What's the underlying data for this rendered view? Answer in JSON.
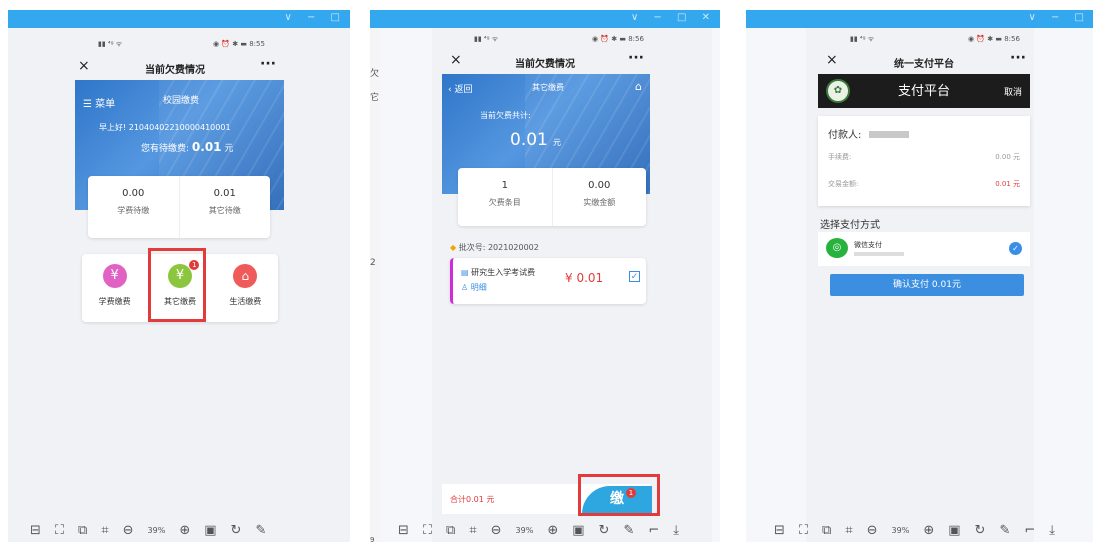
{
  "screen1": {
    "status_time": "8:55",
    "nav_title": "当前欠费情况",
    "menu_label": "菜单",
    "banner_title": "校园缴费",
    "greeting": "早上好! 21040402210000410001",
    "pending_prefix": "您有待缴费:",
    "pending_amount": "0.01",
    "pending_unit": "元",
    "stats": [
      {
        "value": "0.00",
        "label": "学费待缴"
      },
      {
        "value": "0.01",
        "label": "其它待缴"
      }
    ],
    "categories": [
      {
        "label": "学费缴费",
        "color": "#e063c4",
        "icon": "yen-icon"
      },
      {
        "label": "其它缴费",
        "color": "#8cc63f",
        "icon": "yen-icon",
        "badge": "1"
      },
      {
        "label": "生活缴费",
        "color": "#f05a5a",
        "icon": "store-icon"
      }
    ],
    "zoom": "39%"
  },
  "screen2": {
    "status_time": "8:56",
    "nav_title": "当前欠费情况",
    "back_label": "返回",
    "banner_title": "其它缴费",
    "owed_label": "当前欠费共计:",
    "owed_amount": "0.01",
    "owed_unit": "元",
    "stats": [
      {
        "value": "1",
        "label": "欠费条目"
      },
      {
        "value": "0.00",
        "label": "实缴金额"
      }
    ],
    "batch_label": "批次号: 2021020002",
    "item_name": "研究生入学考试费",
    "item_detail": "明细",
    "item_amount": "¥ 0.01",
    "total_label": "合计0.01  元",
    "pay_button_label": "缴",
    "pay_badge": "1",
    "zoom": "39%",
    "side_chars": [
      "欠",
      "它",
      "2",
      "9"
    ]
  },
  "screen3": {
    "status_time": "8:56",
    "nav_title": "统一支付平台",
    "header_title": "支付平台",
    "cancel_label": "取消",
    "payer_label": "付款人:",
    "fee_label": "手续费:",
    "fee_value": "0.00 元",
    "amount_label": "交易金额:",
    "amount_value": "0.01 元",
    "method_title": "选择支付方式",
    "method_name": "微信支付",
    "confirm_label": "确认支付 0.01元",
    "zoom": "39%"
  }
}
